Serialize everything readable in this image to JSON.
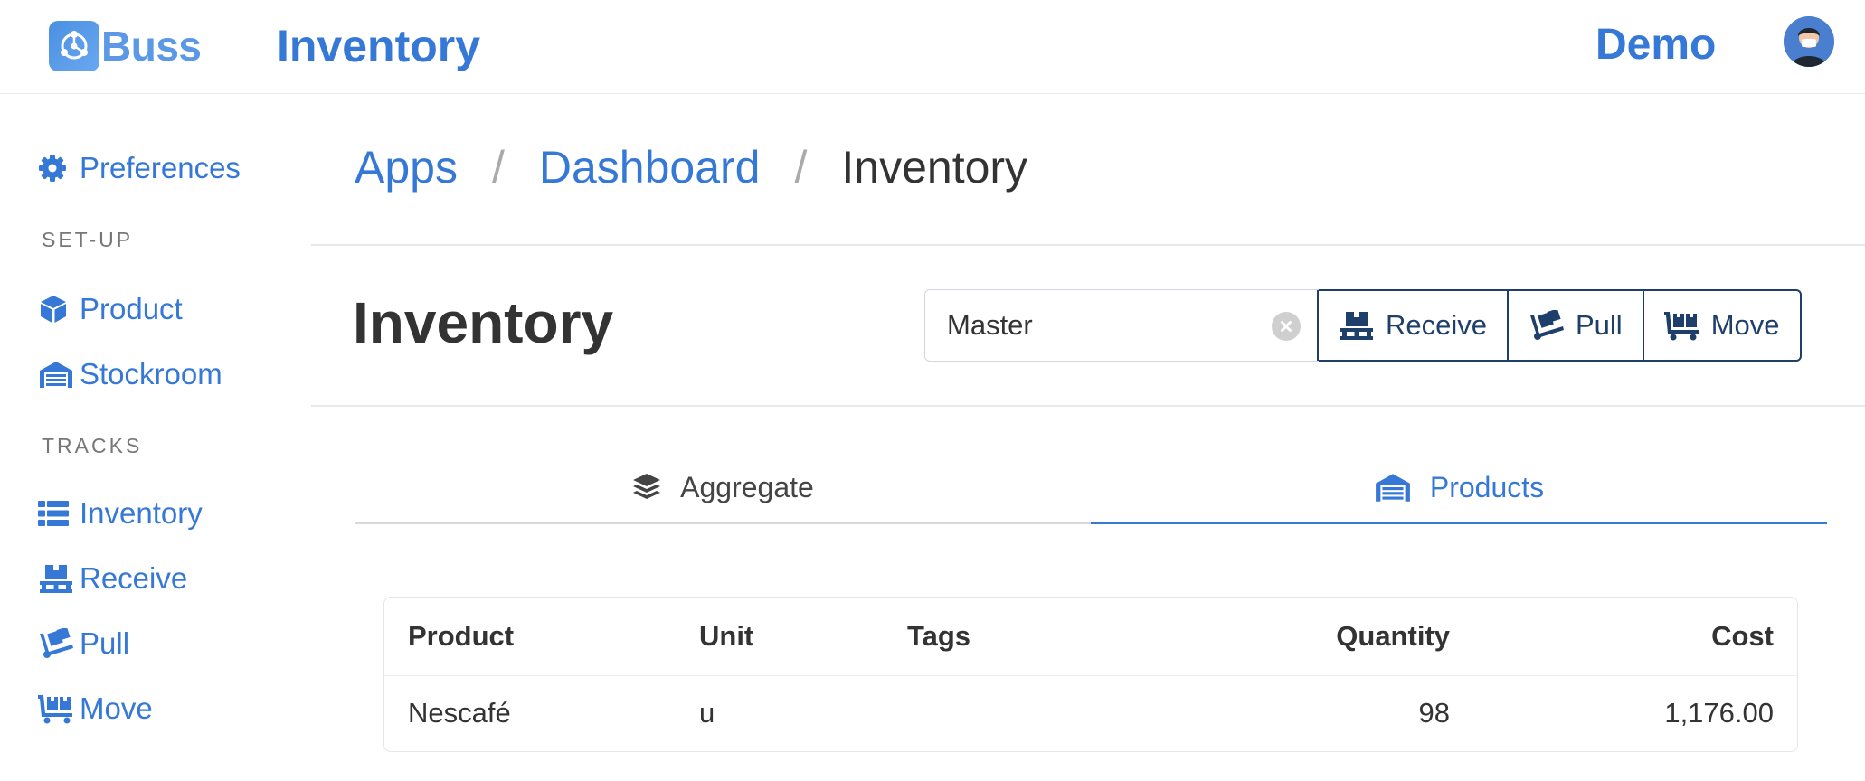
{
  "header": {
    "logo_text": "Buss",
    "app_title": "Inventory",
    "user_name": "Demo"
  },
  "sidebar": {
    "preferences": "Preferences",
    "section_setup": "SET-UP",
    "product": "Product",
    "stockroom": "Stockroom",
    "section_tracks": "TRACKS",
    "inventory": "Inventory",
    "receive": "Receive",
    "pull": "Pull",
    "move": "Move"
  },
  "breadcrumb": {
    "items": [
      "Apps",
      "Dashboard",
      "Inventory"
    ],
    "separator": "/"
  },
  "page": {
    "title": "Inventory"
  },
  "toolbar": {
    "stockroom_value": "Master",
    "receive_label": "Receive",
    "pull_label": "Pull",
    "move_label": "Move"
  },
  "tabs": [
    {
      "label": "Aggregate",
      "icon": "layers-icon",
      "active": false
    },
    {
      "label": "Products",
      "icon": "warehouse-icon",
      "active": true
    }
  ],
  "table": {
    "columns": [
      "Product",
      "Unit",
      "Tags",
      "Quantity",
      "Cost"
    ],
    "rows": [
      {
        "product": "Nescafé",
        "unit": "u",
        "tags": "",
        "quantity": "98",
        "cost": "1,176.00"
      }
    ]
  },
  "colors": {
    "accent": "#3578d6",
    "button_border": "#1f3f6b",
    "text": "#333333"
  }
}
